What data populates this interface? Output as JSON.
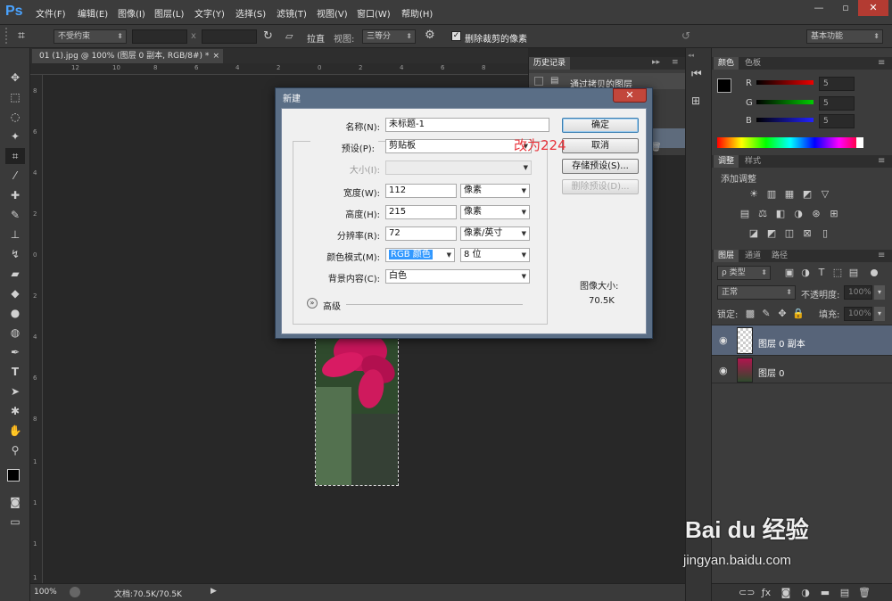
{
  "app": {
    "logo": "Ps",
    "menu": [
      "文件(F)",
      "编辑(E)",
      "图像(I)",
      "图层(L)",
      "文字(Y)",
      "选择(S)",
      "滤镜(T)",
      "视图(V)",
      "窗口(W)",
      "帮助(H)"
    ],
    "window": {
      "minimize": "—",
      "restore": "▫",
      "close": "✕"
    }
  },
  "options": {
    "ratio": "不受约束",
    "x_sep": "x",
    "straighten": "拉直",
    "view_label": "视图:",
    "view_value": "三等分",
    "delete_cropped": "删除裁剪的像素",
    "workspace": "基本功能"
  },
  "document": {
    "tab": "01 (1).jpg @ 100% (图层 0 副本, RGB/8#) *",
    "tab_close": "×",
    "ruler_top": [
      "12",
      "10",
      "8",
      "6",
      "4",
      "2",
      "0",
      "2",
      "4",
      "6",
      "8"
    ],
    "ruler_left": [
      "8",
      "6",
      "4",
      "2",
      "0",
      "2",
      "4",
      "6",
      "8",
      "1",
      "1",
      "1",
      "1"
    ],
    "zoom": "100%",
    "doc_size": "文档:70.5K/70.5K"
  },
  "history": {
    "title": "历史记录",
    "item": "通过拷贝的图层"
  },
  "color_panel": {
    "tabs": [
      "颜色",
      "色板"
    ],
    "channels": [
      {
        "label": "R",
        "value": "5"
      },
      {
        "label": "G",
        "value": "5"
      },
      {
        "label": "B",
        "value": "5"
      }
    ]
  },
  "adjust_panel": {
    "tabs": [
      "调整",
      "样式"
    ],
    "title": "添加调整"
  },
  "layers_panel": {
    "tabs": [
      "图层",
      "通道",
      "路径"
    ],
    "filter_kind": "ρ 类型",
    "blend_mode": "正常",
    "opacity_label": "不透明度:",
    "opacity": "100%",
    "lock_label": "锁定:",
    "fill_label": "填充:",
    "fill": "100%",
    "layers": [
      {
        "name": "图层 0 副本",
        "selected": true
      },
      {
        "name": "图层 0",
        "selected": false
      }
    ]
  },
  "dialog": {
    "title": "新建",
    "name_label": "名称(N):",
    "name_value": "未标题-1",
    "preset_label": "预设(P):",
    "preset_value": "剪贴板",
    "size_label": "大小(I):",
    "width_label": "宽度(W):",
    "width_value": "112",
    "width_unit": "像素",
    "height_label": "高度(H):",
    "height_value": "215",
    "height_unit": "像素",
    "res_label": "分辨率(R):",
    "res_value": "72",
    "res_unit": "像素/英寸",
    "mode_label": "颜色模式(M):",
    "mode_value": "RGB 颜色",
    "mode_bits": "8 位",
    "bg_label": "背景内容(C):",
    "bg_value": "白色",
    "advanced": "高级",
    "ok": "确定",
    "cancel": "取消",
    "save_preset": "存储预设(S)...",
    "delete_preset": "删除预设(D)...",
    "image_size_label": "图像大小:",
    "image_size_value": "70.5K"
  },
  "annotation": {
    "text": "改为224",
    "color": "#e8333a"
  },
  "watermark": {
    "brand": "Bai du 经验",
    "url": "jingyan.baidu.com"
  }
}
